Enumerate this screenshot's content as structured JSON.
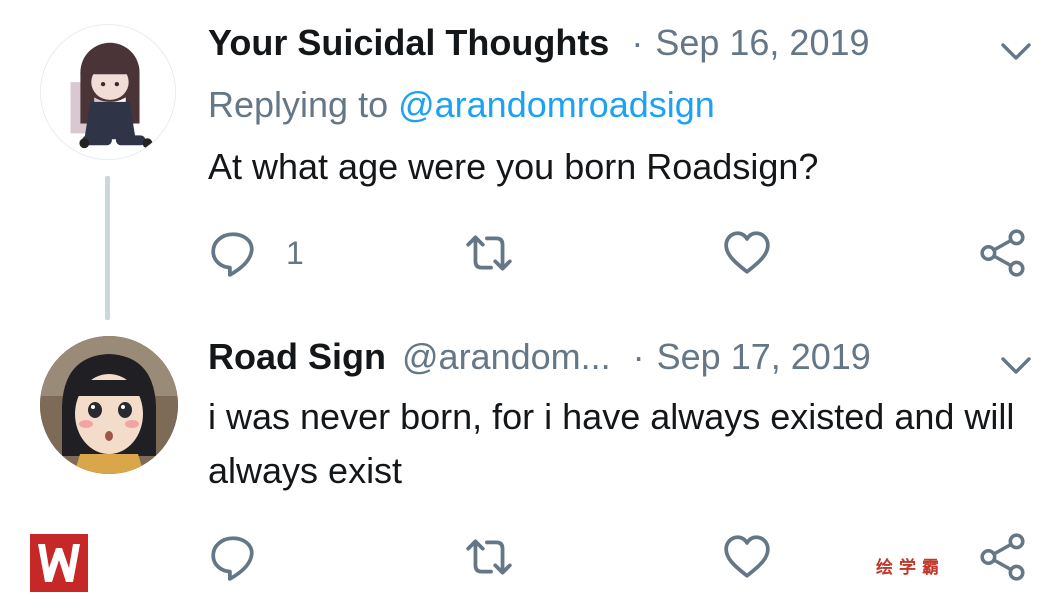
{
  "colors": {
    "text_primary": "#14171a",
    "text_secondary": "#657786",
    "link": "#1da1f2",
    "thread_line": "#ccd6dd",
    "watermark": "#c0392b"
  },
  "tweets": [
    {
      "display_name": "Your Suicidal Thoughts",
      "handle": "",
      "separator": "·",
      "date": "Sep 16, 2019",
      "replying_prefix": "Replying to ",
      "replying_handle": "@arandomroadsign",
      "text": "At what age were you born Roadsign?",
      "reply_count": "1",
      "icons": {
        "menu": "chevron-down-icon",
        "reply": "reply-icon",
        "retweet": "retweet-icon",
        "like": "heart-icon",
        "share": "share-icon"
      }
    },
    {
      "display_name": "Road Sign",
      "handle": "@arandom...",
      "separator": "·",
      "date": "Sep 17, 2019",
      "text": "i was never born, for i have always existed and will always exist",
      "reply_count": "",
      "icons": {
        "menu": "chevron-down-icon",
        "reply": "reply-icon",
        "retweet": "retweet-icon",
        "like": "heart-icon",
        "share": "share-icon"
      }
    }
  ],
  "watermark": {
    "logo": "w-logo-icon",
    "text": "绘学霸"
  }
}
